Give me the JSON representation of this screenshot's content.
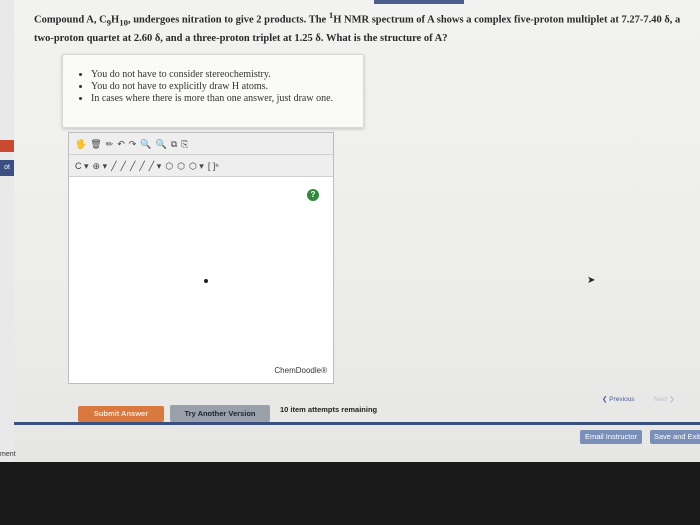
{
  "question": {
    "prefix": "Compound A, C",
    "c_sub": "9",
    "h": "H",
    "h_sub": "10",
    "middle": ", undergoes nitration to give 2 products. The ",
    "nmr_sup": "1",
    "rest": "H NMR spectrum of A shows a complex five-proton multiplet at 7.27-7.40 δ, a two-proton quartet at 2.60 δ, and a three-proton triplet at 1.25 δ. What is the structure of A?"
  },
  "hints": [
    "You do not have to consider stereochemistry.",
    "You do not have to explicitly draw H atoms.",
    "In cases where there is more than one answer, just draw one."
  ],
  "editor": {
    "toolbar1": [
      "🖐",
      "🗑",
      "✏",
      "↶",
      "↷",
      "🔍",
      "🔍",
      "⧉",
      "⎘"
    ],
    "toolbar2": [
      "C ▾",
      "⊕ ▾",
      "╱",
      "╱",
      "╱",
      "╱",
      "╱ ▾",
      "⬡",
      "⬡",
      "⬡ ▾",
      "[ ]ⁿ"
    ],
    "help": "?",
    "brand": "ChemDoodle®"
  },
  "buttons": {
    "submit": "Submit Answer",
    "try_another": "Try Another Version",
    "attempts": "10 item attempts remaining",
    "previous": "Previous",
    "next": "Next",
    "email": "Email Instructor",
    "save_exit": "Save and Exit"
  },
  "side": {
    "tab_label": "ot",
    "bottom_label": "ment"
  },
  "colors": {
    "accent": "#3a4f82",
    "submit": "#d9783f",
    "try": "#9aa1ab",
    "help": "#2f8a3b"
  }
}
